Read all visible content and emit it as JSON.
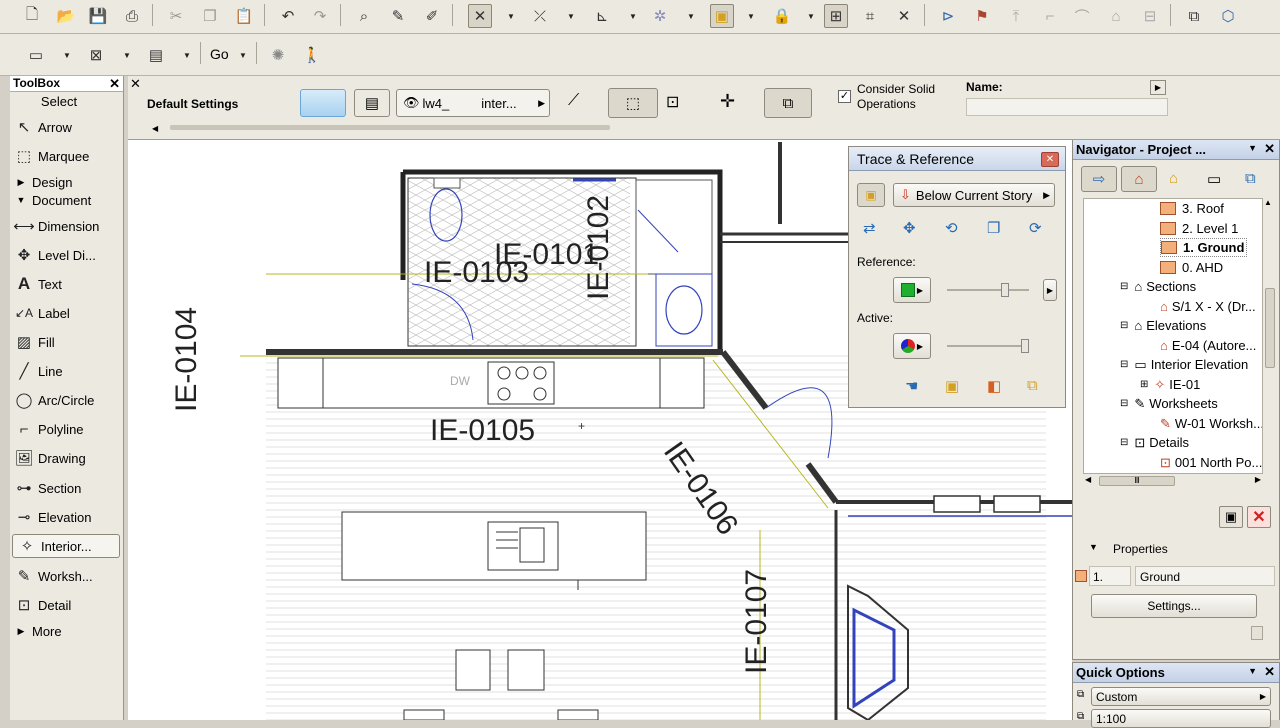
{
  "toolbar2": {
    "go_label": "Go"
  },
  "toolbox": {
    "title": "ToolBox",
    "select_label": "Select",
    "tools_top": [
      {
        "label": "Arrow",
        "icon": "arrow-icon"
      },
      {
        "label": "Marquee",
        "icon": "marquee-icon"
      }
    ],
    "group_design": "Design",
    "group_document": "Document",
    "tools_doc": [
      {
        "label": "Dimension",
        "icon": "dimension-icon"
      },
      {
        "label": "Level Di...",
        "icon": "level-dimension-icon"
      },
      {
        "label": "Text",
        "icon": "text-icon"
      },
      {
        "label": "Label",
        "icon": "label-icon"
      },
      {
        "label": "Fill",
        "icon": "fill-icon"
      },
      {
        "label": "Line",
        "icon": "line-icon"
      },
      {
        "label": "Arc/Circle",
        "icon": "arc-circle-icon"
      },
      {
        "label": "Polyline",
        "icon": "polyline-icon"
      },
      {
        "label": "Drawing",
        "icon": "drawing-icon"
      },
      {
        "label": "Section",
        "icon": "section-icon"
      },
      {
        "label": "Elevation",
        "icon": "elevation-icon"
      },
      {
        "label": "Interior...",
        "icon": "interior-elevation-icon"
      },
      {
        "label": "Worksh...",
        "icon": "worksheet-icon"
      },
      {
        "label": "Detail",
        "icon": "detail-icon"
      }
    ],
    "group_more": "More"
  },
  "infobox": {
    "default_settings": "Default Settings",
    "layer_name": "lw4_",
    "layer_suffix": "inter...",
    "consider_solid": "Consider Solid",
    "operations": "Operations",
    "name_label": "Name:"
  },
  "trace": {
    "title": "Trace & Reference",
    "below_story": "Below Current Story",
    "reference_label": "Reference:",
    "active_label": "Active:"
  },
  "navigator": {
    "title": "Navigator - Project ...",
    "items": [
      {
        "label": "3. Roof"
      },
      {
        "label": "2. Level 1"
      },
      {
        "label": "1. Ground"
      },
      {
        "label": "0. AHD"
      },
      {
        "label": "Sections"
      },
      {
        "label": "S/1 X - X (Dr..."
      },
      {
        "label": "Elevations"
      },
      {
        "label": "E-04 (Autore..."
      },
      {
        "label": "Interior Elevation"
      },
      {
        "label": "IE-01"
      },
      {
        "label": "Worksheets"
      },
      {
        "label": "W-01 Worksh..."
      },
      {
        "label": "Details"
      },
      {
        "label": "001 North Po..."
      }
    ],
    "properties_label": "Properties",
    "prop_id": "1.",
    "prop_name": "Ground",
    "settings_button": "Settings..."
  },
  "quick_options": {
    "title": "Quick Options",
    "custom": "Custom",
    "scale": "1:100"
  },
  "plan": {
    "marker_0101": "IE-0101",
    "marker_0102": "IE-0102",
    "marker_0103": "IE-0103",
    "marker_0104": "IE-0104",
    "marker_0105": "IE-0105",
    "marker_0106": "IE-0106",
    "marker_0107": "IE-0107",
    "dw_label": "DW"
  }
}
